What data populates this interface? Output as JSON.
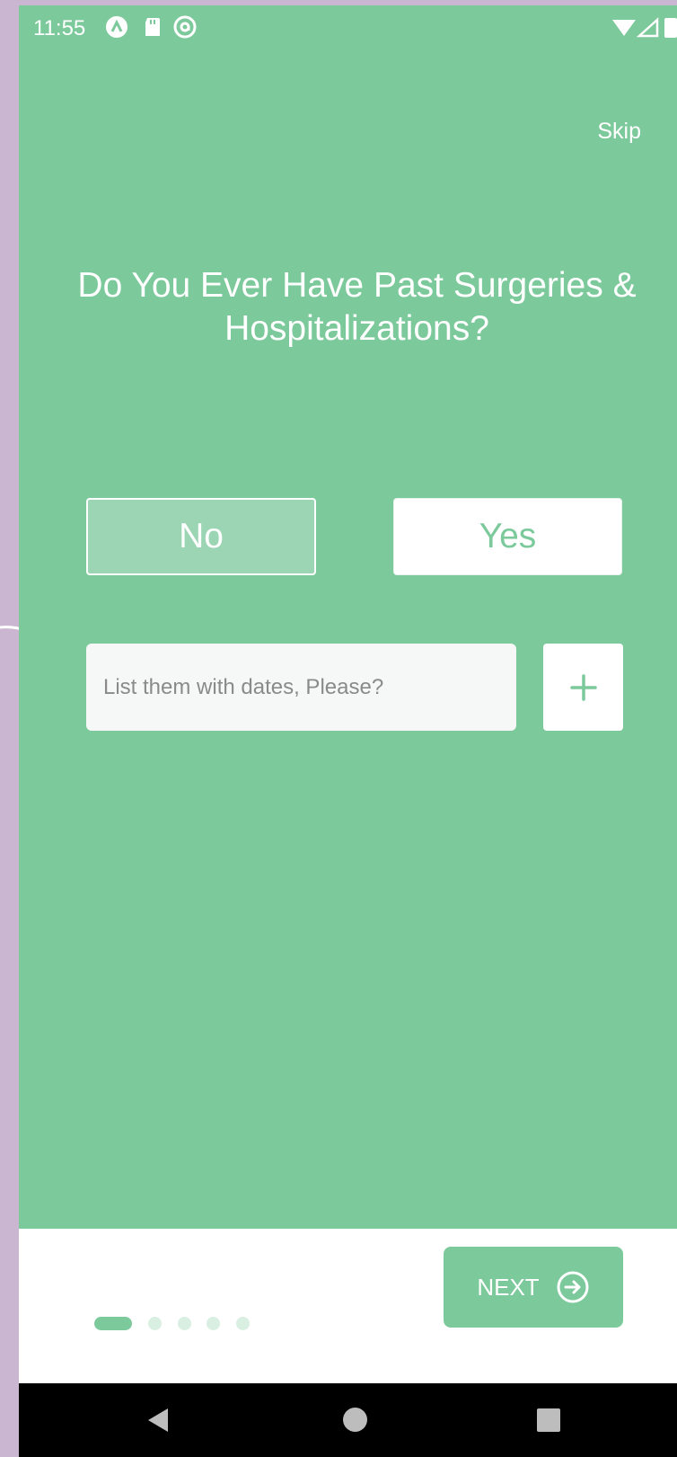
{
  "status_bar": {
    "time": "11:55",
    "icons": [
      "app-a-icon",
      "sd-card-icon",
      "at-sign-icon",
      "wifi-icon",
      "signal-icon",
      "battery-icon"
    ]
  },
  "onboarding": {
    "skip_label": "Skip",
    "question_line1": "Do You Ever Have Past Surgeries &",
    "question_line2": "Hospitalizations?",
    "choice_no": "No",
    "choice_yes": "Yes",
    "selected_choice": "No",
    "entry_placeholder": "List them with dates, Please?",
    "add_icon": "plus-icon"
  },
  "footer": {
    "next_label": "NEXT",
    "next_icon": "arrow-circle-right-icon",
    "page_count": 5,
    "current_page": 1
  },
  "nav_bar": {
    "icons": [
      "back-icon",
      "home-icon",
      "recents-icon"
    ]
  },
  "colors": {
    "primary": "#7cc99b",
    "background_outer": "#cbb6d1",
    "text_light": "#ffffff",
    "input_bg": "#f6f8f7"
  }
}
